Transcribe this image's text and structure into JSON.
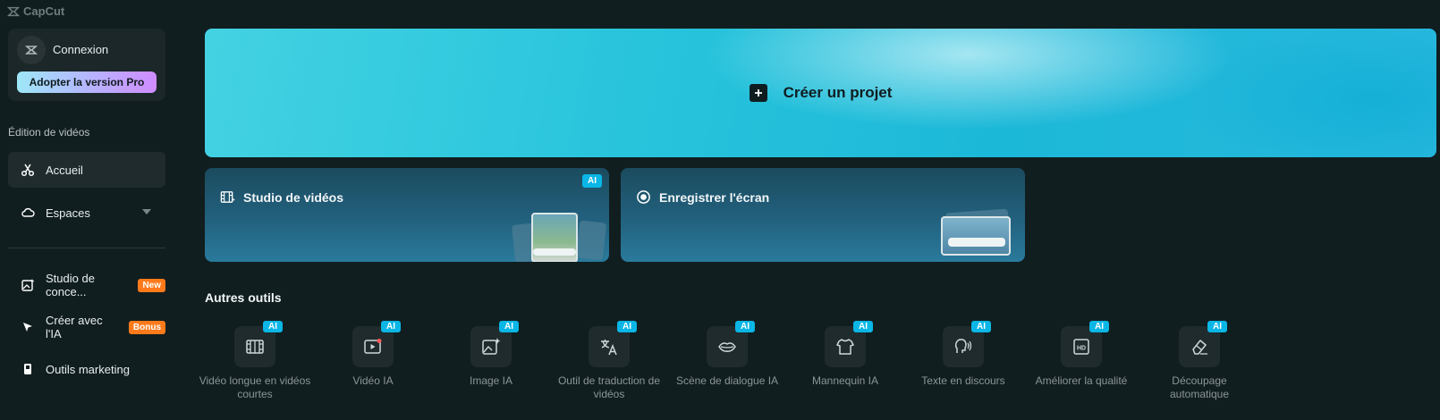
{
  "app": {
    "logo_text": "CapCut"
  },
  "sidebar": {
    "login_label": "Connexion",
    "pro_button": "Adopter la version Pro",
    "section_title": "Édition de vidéos",
    "items": [
      {
        "label": "Accueil",
        "icon": "scissors-icon",
        "active": true
      },
      {
        "label": "Espaces",
        "icon": "cloud-icon"
      },
      {
        "label": "Studio de conce...",
        "icon": "image-sparkle-icon",
        "badge": "New"
      },
      {
        "label": "Créer avec l'IA",
        "icon": "spark-icon",
        "badge": "Bonus"
      },
      {
        "label": "Outils marketing",
        "icon": "marketing-icon"
      }
    ]
  },
  "main": {
    "hero_title": "Créer un projet",
    "tiles": [
      {
        "title": "Studio de vidéos",
        "badge": "AI"
      },
      {
        "title": "Enregistrer l'écran"
      }
    ],
    "others_title": "Autres outils",
    "ai_badge": "AI",
    "tools": [
      {
        "label": "Vidéo longue en vidéos courtes",
        "icon": "film-split-icon"
      },
      {
        "label": "Vidéo IA",
        "icon": "video-play-icon"
      },
      {
        "label": "Image IA",
        "icon": "image-sparkle-icon"
      },
      {
        "label": "Outil de traduction de vidéos",
        "icon": "translate-icon"
      },
      {
        "label": "Scène de dialogue IA",
        "icon": "lips-icon"
      },
      {
        "label": "Mannequin IA",
        "icon": "shirt-icon"
      },
      {
        "label": "Texte en discours",
        "icon": "speech-icon"
      },
      {
        "label": "Améliorer la qualité",
        "icon": "hd-icon"
      },
      {
        "label": "Découpage automatique",
        "icon": "eraser-icon"
      }
    ]
  },
  "colors": {
    "background": "#111e1f",
    "accent": "#0ab6e6",
    "badge_orange": "#ff7a1a"
  }
}
